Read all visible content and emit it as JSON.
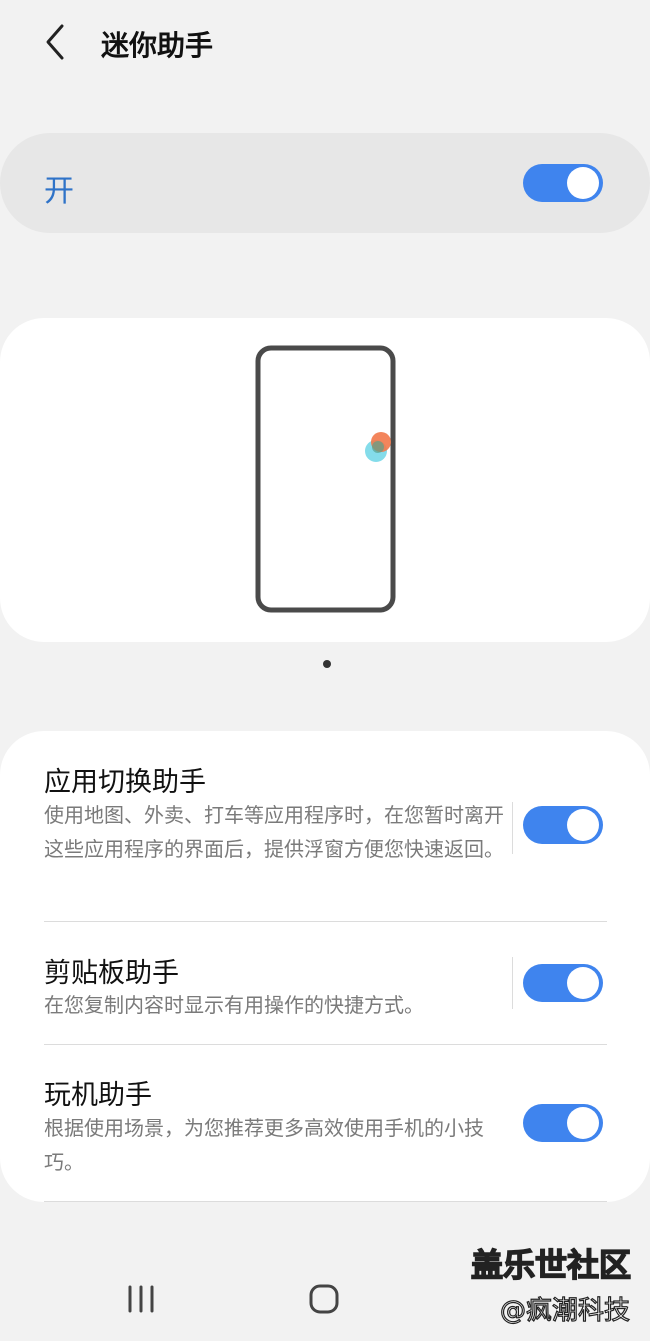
{
  "header": {
    "title": "迷你助手",
    "back_icon": "chevron-left-icon"
  },
  "master": {
    "label": "开",
    "enabled": true
  },
  "illustration": {
    "phone_icon": "phone-outline",
    "bubble_colors": [
      "#f2784a",
      "#6fd6e6"
    ],
    "page_indicator_count": 1
  },
  "items": [
    {
      "title": "应用切换助手",
      "desc": "使用地图、外卖、打车等应用程序时，在您暂时离开这些应用程序的界面后，提供浮窗方便您快速返回。",
      "enabled": true
    },
    {
      "title": "剪贴板助手",
      "desc": "在您复制内容时显示有用操作的快捷方式。",
      "enabled": true
    },
    {
      "title": "玩机助手",
      "desc": "根据使用场景，为您推荐更多高效使用手机的小技巧。",
      "enabled": true
    }
  ],
  "navbar": {
    "recents_icon": "recents-icon",
    "home_icon": "home-icon"
  },
  "watermark": {
    "line1": "盖乐世社区",
    "line2": "@疯潮科技"
  },
  "colors": {
    "accent": "#3f84ee",
    "master_label": "#2f73c8",
    "background": "#f2f2f2"
  }
}
